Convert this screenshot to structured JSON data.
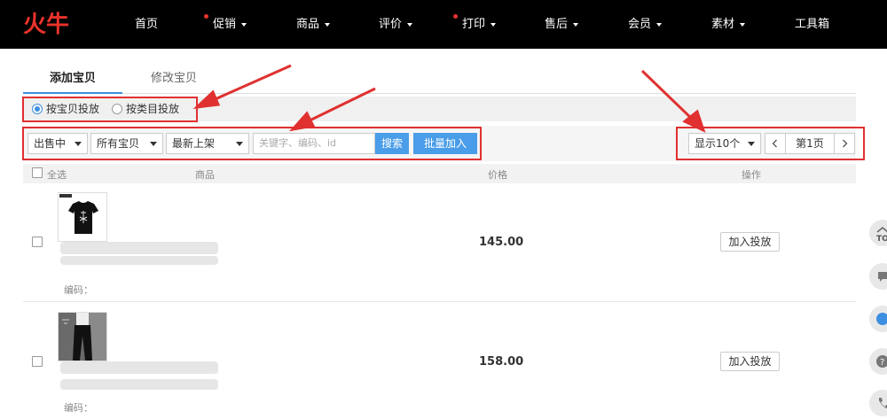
{
  "nav": {
    "logo": "火牛",
    "items": [
      {
        "label": "首页",
        "caret": false,
        "dot": false
      },
      {
        "label": "促销",
        "caret": true,
        "dot": true
      },
      {
        "label": "商品",
        "caret": true,
        "dot": false
      },
      {
        "label": "评价",
        "caret": true,
        "dot": false
      },
      {
        "label": "打印",
        "caret": true,
        "dot": true
      },
      {
        "label": "售后",
        "caret": true,
        "dot": false
      },
      {
        "label": "会员",
        "caret": true,
        "dot": false
      },
      {
        "label": "素材",
        "caret": true,
        "dot": false
      },
      {
        "label": "工具箱",
        "caret": false,
        "dot": false
      }
    ]
  },
  "tabs": {
    "add": "添加宝贝",
    "edit": "修改宝贝"
  },
  "radios": {
    "by_item": "按宝贝投放",
    "by_category": "按类目投放"
  },
  "filters": {
    "status": "出售中",
    "scope": "所有宝贝",
    "sort": "最新上架",
    "search_placeholder": "关键字、编码、id",
    "search_button": "搜索",
    "batch_button": "批量加入",
    "page_size": "显示10个",
    "page_label": "第1页"
  },
  "table": {
    "select_all": "全选",
    "col_product": "商品",
    "col_price": "价格",
    "col_action": "操作"
  },
  "rows": [
    {
      "price": "145.00",
      "action": "加入投放",
      "code_label": "编码："
    },
    {
      "price": "158.00",
      "action": "加入投放",
      "code_label": "编码："
    }
  ],
  "side": {
    "top_label": "TO"
  },
  "colors": {
    "accent": "#4a9de8",
    "brand_red": "#e8332b",
    "annotation": "#e03030"
  }
}
